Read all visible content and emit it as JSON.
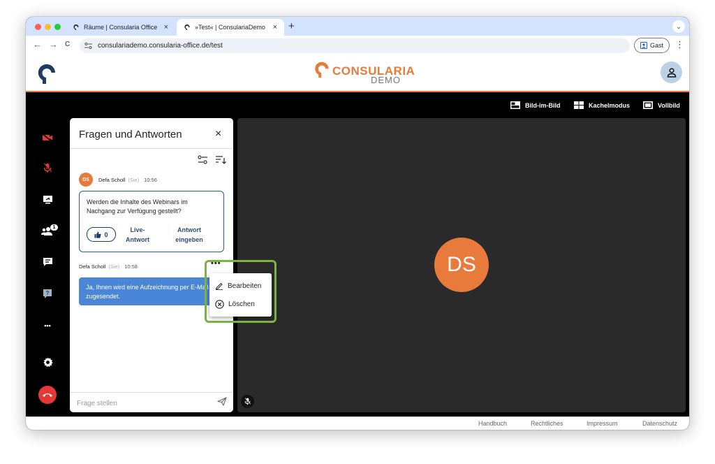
{
  "browser": {
    "tabs": [
      {
        "title": "Räume | Consularia Office",
        "close": "×"
      },
      {
        "title": "»Test« | ConsulariaDemo",
        "close": "×"
      }
    ],
    "new_tab": "+",
    "tab_menu": "⌄",
    "nav": {
      "back": "←",
      "forward": "→",
      "reload": "C"
    },
    "url": "consulariademo.consularia-office.de/test",
    "profile_label": "Gast",
    "menu": "⋮"
  },
  "header": {
    "brand_name": "CONSULARIA",
    "brand_sub": "DEMO"
  },
  "view_options": [
    {
      "label": "Bild-im-Bild",
      "icon": "picture-in-picture-icon"
    },
    {
      "label": "Kachelmodus",
      "icon": "tile-grid-icon"
    },
    {
      "label": "Vollbild",
      "icon": "fullscreen-icon"
    }
  ],
  "rail": {
    "participants_badge": "1",
    "more": "•••"
  },
  "qa": {
    "title": "Fragen und Antworten",
    "close": "×",
    "question": {
      "author_initials": "DS",
      "author": "Defa Scholl",
      "you_label": "(Sie)",
      "time": "10:56",
      "text": "Werden die Inhalte des Webinars im Nachgang zur Verfügung gestellt?",
      "likes": "0",
      "live_answer": "Live-\nAntwort",
      "enter_answer": "Antwort\neingeben"
    },
    "answer": {
      "author": "Defa Scholl",
      "you_label": "(Sie)",
      "time": "10:58",
      "text": "Ja, Ihnen wird eine Aufzeichnung per E-Mail zugesendet.",
      "more": "•••"
    },
    "ask_placeholder": "Frage stellen"
  },
  "context_menu": {
    "edit": "Bearbeiten",
    "delete": "Löschen"
  },
  "video": {
    "initials": "DS"
  },
  "footer": {
    "links": [
      "Handbuch",
      "Rechtliches",
      "Impressum",
      "Datenschutz"
    ]
  },
  "colors": {
    "brand_orange": "#e87a3c",
    "answer_blue": "#4a86d8",
    "highlight_green": "#7cb342",
    "hangup_red": "#e53935",
    "muted_red": "#e53935"
  }
}
